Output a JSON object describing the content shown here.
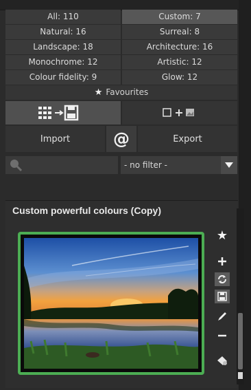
{
  "categories": {
    "all": "All: 110",
    "custom": "Custom: 7",
    "natural": "Natural: 16",
    "surreal": "Surreal: 8",
    "landscape": "Landscape: 18",
    "architecture": "Architecture: 16",
    "monochrome": "Monochrome: 12",
    "artistic": "Artistic: 12",
    "colour_fidelity": "Colour fidelity: 9",
    "glow": "Glow: 12"
  },
  "favourites_label": "Favourites",
  "import_label": "Import",
  "export_label": "Export",
  "at_symbol": "@",
  "filter": {
    "selected": "- no filter -",
    "search_placeholder": ""
  },
  "preset": {
    "title": "Custom powerful colours (Copy)"
  },
  "icons": {
    "grid_to_save": "grid-arrow-save-icon",
    "merge": "square-plus-image-icon",
    "search": "search-icon",
    "dropdown": "triangle-down-icon",
    "favourite": "star-icon",
    "add": "plus-icon",
    "refresh": "refresh-icon",
    "save": "save-icon",
    "edit": "pencil-icon",
    "remove": "minus-icon",
    "delete": "delete-icon"
  },
  "colors": {
    "selection_border": "#4cad53",
    "panel": "#2b2b2b"
  }
}
